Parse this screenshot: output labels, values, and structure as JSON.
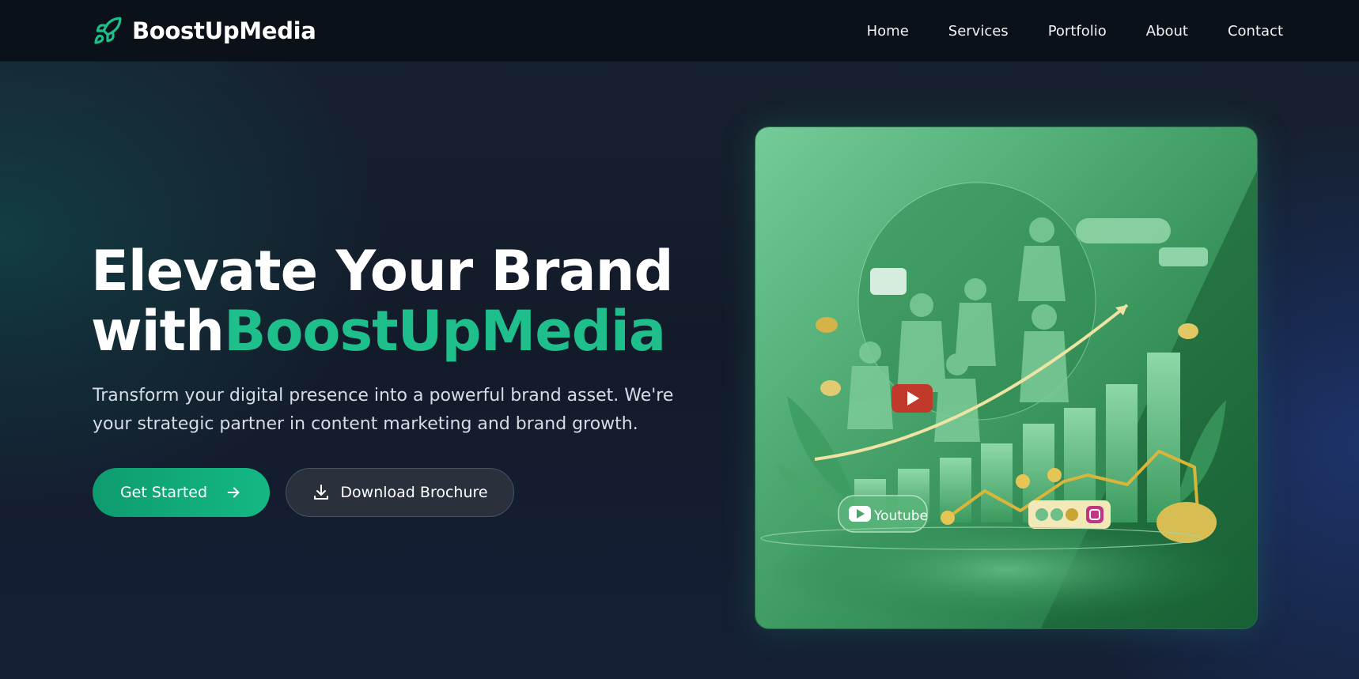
{
  "brand": {
    "name": "BoostUpMedia",
    "icon": "rocket-icon",
    "accent_color": "#1fbf8b"
  },
  "nav": {
    "items": [
      {
        "label": "Home"
      },
      {
        "label": "Services"
      },
      {
        "label": "Portfolio"
      },
      {
        "label": "About"
      },
      {
        "label": "Contact"
      }
    ]
  },
  "hero": {
    "title_line1": "Elevate Your Brand",
    "title_with": "with",
    "title_brand": "BoostUpMedia",
    "subtitle": "Transform your digital presence into a powerful brand asset. We're your strategic partner in content marketing and brand growth.",
    "cta_primary": "Get Started",
    "cta_primary_icon": "arrow-right-icon",
    "cta_secondary": "Download Brochure",
    "cta_secondary_icon": "download-icon",
    "image": {
      "labels": {
        "youtube": "Youtube"
      },
      "background_color": "#1f7a45"
    }
  }
}
